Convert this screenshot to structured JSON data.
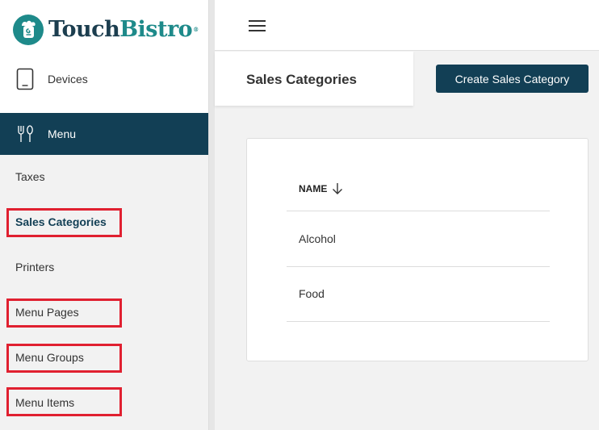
{
  "brand": {
    "part1": "Touch",
    "part2": "Bistro",
    "reg": "®",
    "primary": "#123f55",
    "accent": "#1e8a8a"
  },
  "sidebar": {
    "devices_label": "Devices",
    "menu_label": "Menu",
    "items": [
      {
        "label": "Taxes"
      },
      {
        "label": "Sales Categories"
      },
      {
        "label": "Printers"
      },
      {
        "label": "Menu Pages"
      },
      {
        "label": "Menu Groups"
      },
      {
        "label": "Menu Items"
      }
    ],
    "highlight_color": "#e02030"
  },
  "header": {
    "title": "Sales Categories",
    "create_button_label": "Create Sales Category"
  },
  "table": {
    "column_name": "NAME",
    "rows": [
      {
        "name": "Alcohol"
      },
      {
        "name": "Food"
      }
    ]
  }
}
